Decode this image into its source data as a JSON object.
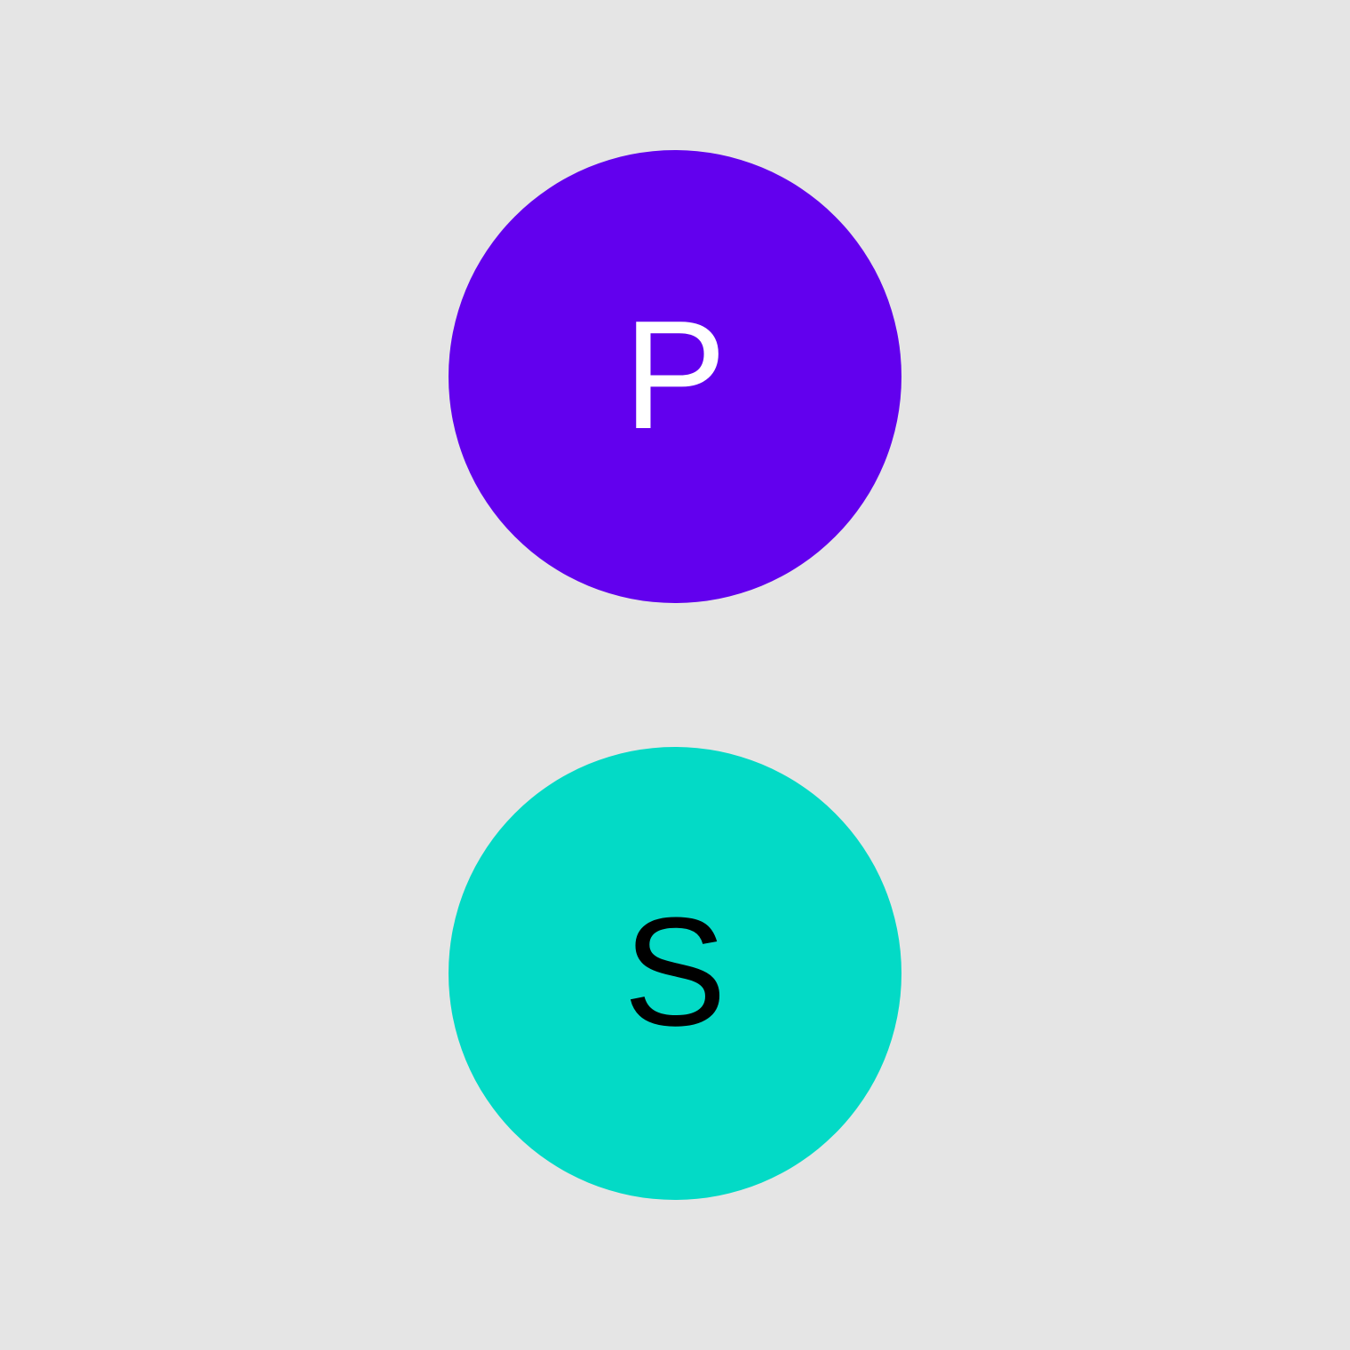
{
  "swatches": [
    {
      "label": "P",
      "background": "#6200ee",
      "text_color": "#ffffff"
    },
    {
      "label": "S",
      "background": "#03dac6",
      "text_color": "#000000"
    }
  ]
}
